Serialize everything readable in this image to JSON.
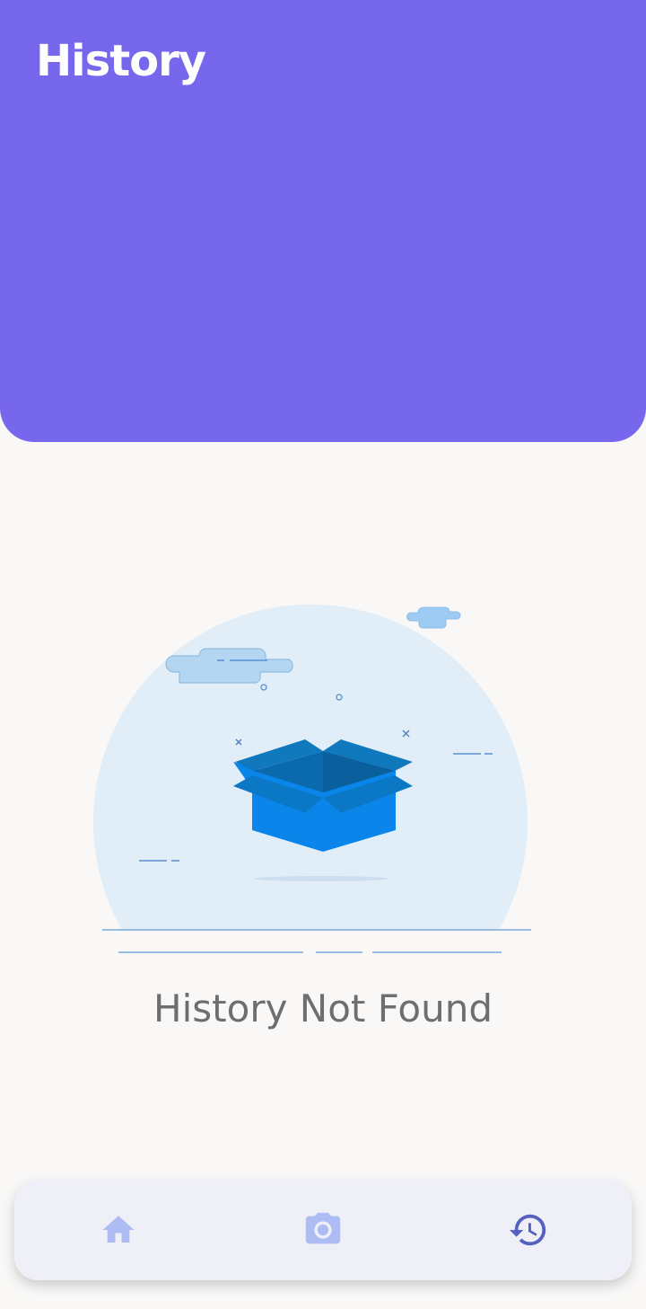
{
  "header": {
    "title": "History"
  },
  "empty_state": {
    "message": "History Not Found"
  },
  "bottom_nav": {
    "items": [
      {
        "icon": "home-icon",
        "active": false
      },
      {
        "icon": "camera-icon",
        "active": false
      },
      {
        "icon": "history-icon",
        "active": true
      }
    ]
  },
  "colors": {
    "header_bg": "#7767ec",
    "background": "#f9f8f7",
    "nav_bg": "#efeff8",
    "nav_inactive": "#aebcf4",
    "nav_active": "#5461c0",
    "box_blue": "#0a85ea"
  }
}
